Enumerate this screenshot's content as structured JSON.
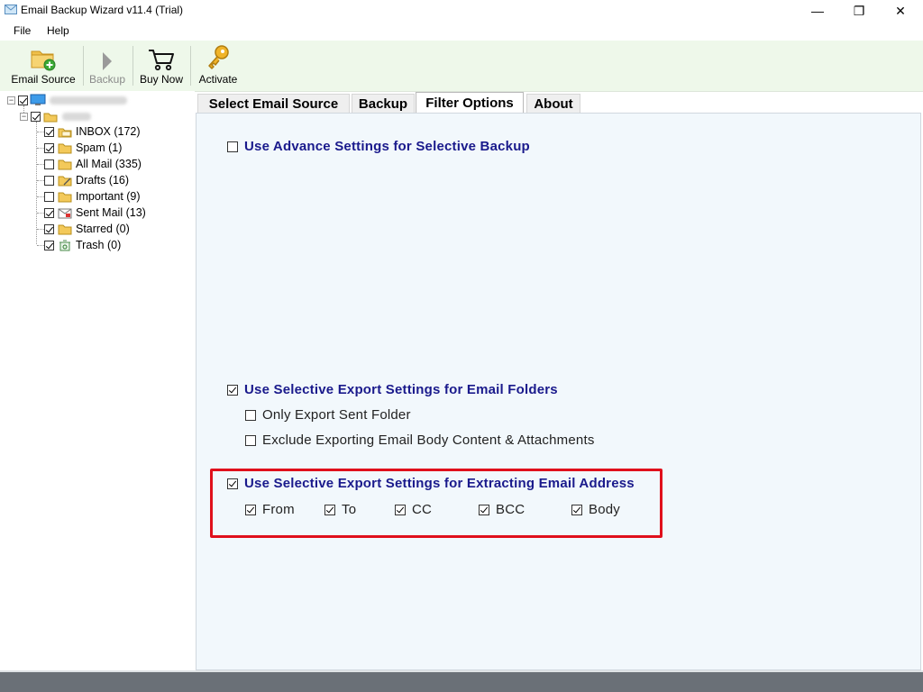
{
  "window": {
    "title": "Email Backup Wizard v11.4 (Trial)",
    "minimize": "—",
    "maximize": "❐",
    "close": "✕"
  },
  "menu": {
    "file": "File",
    "help": "Help"
  },
  "toolbar": {
    "email_source": "Email Source",
    "backup": "Backup",
    "buy_now": "Buy Now",
    "activate": "Activate"
  },
  "tree": {
    "folders": [
      {
        "label": "INBOX (172)",
        "checked": true,
        "icon": "inbox-folder-icon"
      },
      {
        "label": "Spam (1)",
        "checked": true,
        "icon": "folder-icon"
      },
      {
        "label": "All Mail (335)",
        "checked": false,
        "icon": "folder-icon"
      },
      {
        "label": "Drafts (16)",
        "checked": false,
        "icon": "drafts-folder-icon"
      },
      {
        "label": "Important (9)",
        "checked": false,
        "icon": "folder-icon"
      },
      {
        "label": "Sent Mail (13)",
        "checked": true,
        "icon": "sent-folder-icon"
      },
      {
        "label": "Starred (0)",
        "checked": true,
        "icon": "folder-icon"
      },
      {
        "label": "Trash (0)",
        "checked": true,
        "icon": "trash-icon"
      }
    ]
  },
  "tabs": {
    "select_source": "Select Email Source",
    "backup": "Backup",
    "filter_options": "Filter Options",
    "about": "About",
    "active": "filter_options"
  },
  "filter": {
    "advance": {
      "label": "Use Advance Settings for Selective Backup",
      "checked": false
    },
    "folders": {
      "label": "Use Selective Export Settings for Email Folders",
      "checked": true,
      "sent_only": {
        "label": "Only Export Sent Folder",
        "checked": false
      },
      "exclude_body": {
        "label": "Exclude Exporting Email Body Content & Attachments",
        "checked": false
      }
    },
    "address": {
      "label": "Use Selective Export Settings for Extracting Email Address",
      "checked": true,
      "from": {
        "label": "From",
        "checked": true
      },
      "to": {
        "label": "To",
        "checked": true
      },
      "cc": {
        "label": "CC",
        "checked": true
      },
      "bcc": {
        "label": "BCC",
        "checked": true
      },
      "body": {
        "label": "Body",
        "checked": true
      }
    }
  },
  "colors": {
    "toolbar_bg": "#eef8ea",
    "panel_bg": "#f2f8fc",
    "heading_text": "#1a1a8c",
    "highlight_border": "#e0101c"
  }
}
